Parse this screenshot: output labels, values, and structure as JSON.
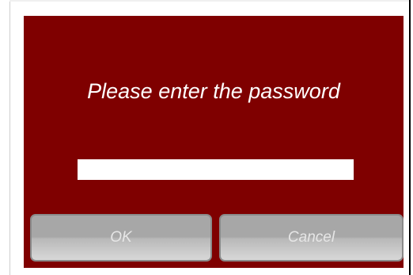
{
  "dialog": {
    "prompt": "Please enter the password",
    "password": {
      "value": "",
      "placeholder": ""
    },
    "ok_label": "OK",
    "cancel_label": "Cancel"
  },
  "colors": {
    "dialog_background": "#7f0000",
    "text": "#ffffff",
    "button_background": "#b0b0b0",
    "button_text": "#e6e6e6"
  }
}
